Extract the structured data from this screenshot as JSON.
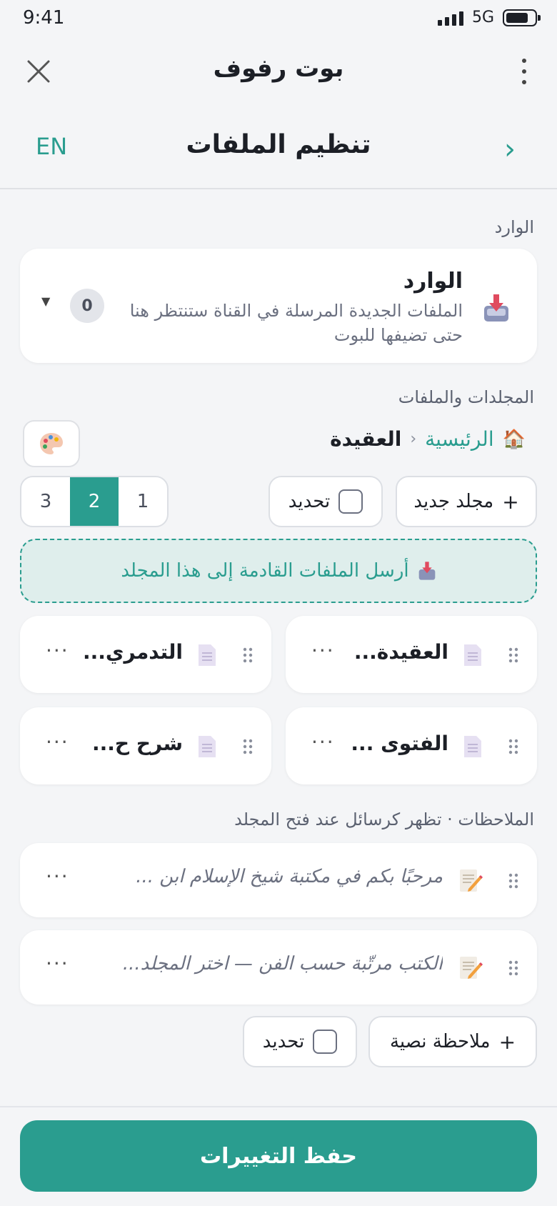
{
  "status_bar": {
    "time": "9:41",
    "network": "5G"
  },
  "app_bar": {
    "title": "بوت رفوف"
  },
  "header": {
    "title": "تنظيم الملفات",
    "lang_toggle": "EN"
  },
  "inbox": {
    "section_label": "الوارد",
    "title": "الوارد",
    "description": "الملفات الجديدة المرسلة في القناة ستنتظر هنا حتى تضيفها للبوت",
    "count": "0"
  },
  "folders": {
    "section_label": "المجلدات والملفات",
    "breadcrumb": {
      "home": "الرئيسية",
      "current": "العقيدة"
    },
    "new_folder_label": "مجلد جديد",
    "select_label": "تحديد",
    "pages": [
      "1",
      "2",
      "3"
    ],
    "active_page": "2",
    "drop_zone_text": "أرسل الملفات القادمة إلى هذا المجلد",
    "files": [
      {
        "name": "العقيدة..."
      },
      {
        "name": "التدمري..."
      },
      {
        "name": "الفتوى ..."
      },
      {
        "name": "شرح ح..."
      }
    ]
  },
  "notes": {
    "section_label": "الملاحظات · تظهر كرسائل عند فتح المجلد",
    "items": [
      {
        "text": "مرحبًا بكم في مكتبة شيخ الإسلام ابن ..."
      },
      {
        "text": "الكتب مرتّبة حسب الفن — اختر المجلد..."
      }
    ],
    "add_note_label": "ملاحظة نصية",
    "select_label": "تحديد"
  },
  "footer": {
    "save_label": "حفظ التغييرات"
  },
  "colors": {
    "accent": "#2a9d8f",
    "background": "#f4f5f7"
  }
}
